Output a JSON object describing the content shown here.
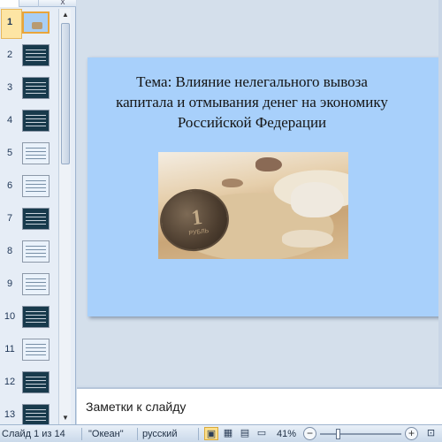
{
  "thumbnails": {
    "items": [
      {
        "num": "1",
        "style": "first"
      },
      {
        "num": "2",
        "style": "dark"
      },
      {
        "num": "3",
        "style": "dark"
      },
      {
        "num": "4",
        "style": "dark"
      },
      {
        "num": "5",
        "style": "light"
      },
      {
        "num": "6",
        "style": "light"
      },
      {
        "num": "7",
        "style": "dark"
      },
      {
        "num": "8",
        "style": "light"
      },
      {
        "num": "9",
        "style": "light"
      },
      {
        "num": "10",
        "style": "dark"
      },
      {
        "num": "11",
        "style": "light"
      },
      {
        "num": "12",
        "style": "dark"
      },
      {
        "num": "13",
        "style": "dark"
      }
    ],
    "selected_index": 0
  },
  "slide": {
    "title": "Тема: Влияние нелегального вывоза капитала и отмывания денег на экономику Российской Федерации",
    "background_color": "#a8d0fb",
    "image": {
      "description_icon": "ruble-coin-on-sand-photo",
      "coin_text": "1",
      "coin_subtext": "РУБЛЬ"
    }
  },
  "notes": {
    "placeholder": "Заметки к слайду"
  },
  "status_bar": {
    "slide_counter": "Слайд 1 из 14",
    "theme": "\"Океан\"",
    "language": "русский",
    "zoom": "41%",
    "zoom_level_percent": 41
  },
  "icons": {
    "scroll_up": "▲",
    "scroll_down": "▼",
    "pane_close": "x",
    "view_normal": "▣",
    "view_sorter": "▦",
    "view_reading": "▤",
    "view_slideshow": "▭",
    "zoom_minus": "−",
    "zoom_plus": "+",
    "zoom_fit": "⊡"
  }
}
